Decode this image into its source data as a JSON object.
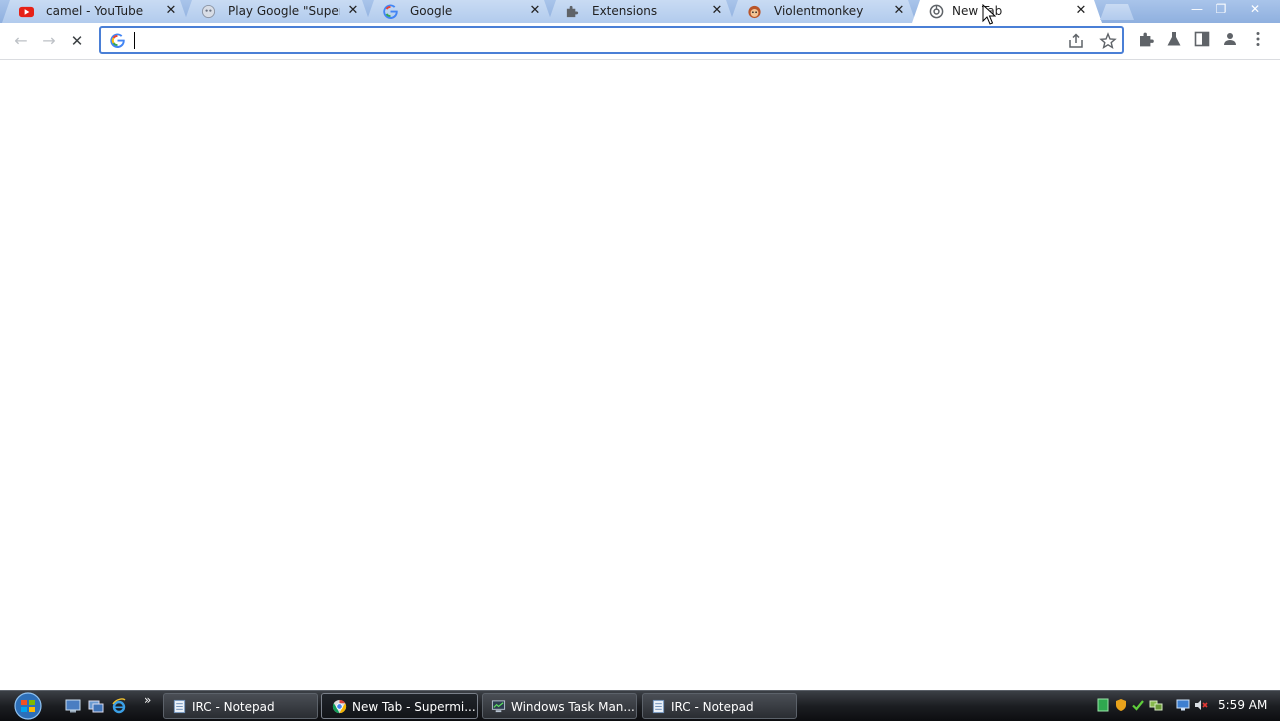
{
  "browser": {
    "tabs": [
      {
        "title": "camel - YouTube",
        "icon": "youtube-icon",
        "active": false
      },
      {
        "title": "Play Google \"Super Mario\"",
        "icon": "game-icon",
        "active": false
      },
      {
        "title": "Google",
        "icon": "google-icon",
        "active": false
      },
      {
        "title": "Extensions",
        "icon": "puzzle-icon",
        "active": false
      },
      {
        "title": "Violentmonkey",
        "icon": "violentmonkey-icon",
        "active": false
      },
      {
        "title": "New Tab",
        "icon": "chrome-icon",
        "active": true
      }
    ],
    "close_glyph": "✕",
    "window_controls": {
      "minimize": "—",
      "restore": "❐",
      "close": "✕"
    },
    "omnibox": {
      "value": "",
      "placeholder": "",
      "provider_icon": "google-g-icon"
    },
    "toolbar_icons": [
      "share-icon",
      "star-icon",
      "extensions-icon",
      "labs-icon",
      "side-panel-icon",
      "profile-icon",
      "menu-icon"
    ],
    "nav": {
      "back": "←",
      "forward": "→",
      "stop": "✕"
    }
  },
  "taskbar": {
    "tasks": [
      {
        "label": "IRC - Notepad",
        "icon": "notepad-icon",
        "active": false
      },
      {
        "label": "New Tab - Supermi...",
        "icon": "chrome-icon",
        "active": true
      },
      {
        "label": "Windows Task Man...",
        "icon": "task-manager-icon",
        "active": false
      },
      {
        "label": "IRC - Notepad",
        "icon": "notepad-icon",
        "active": false
      }
    ],
    "quick_launch": [
      "show-desktop-icon",
      "switch-windows-icon",
      "ie-icon"
    ],
    "overflow": "»",
    "tray_icons": [
      "green-app-icon",
      "shield-icon",
      "check-icon",
      "network-icon",
      "monitor-icon",
      "volume-muted-icon"
    ],
    "clock": "5:59 AM"
  },
  "colors": {
    "tabstrip_bg": "#9ab8e4",
    "omnibox_focus": "#4a7fd6",
    "taskbar_bg": "#1c1e22"
  }
}
